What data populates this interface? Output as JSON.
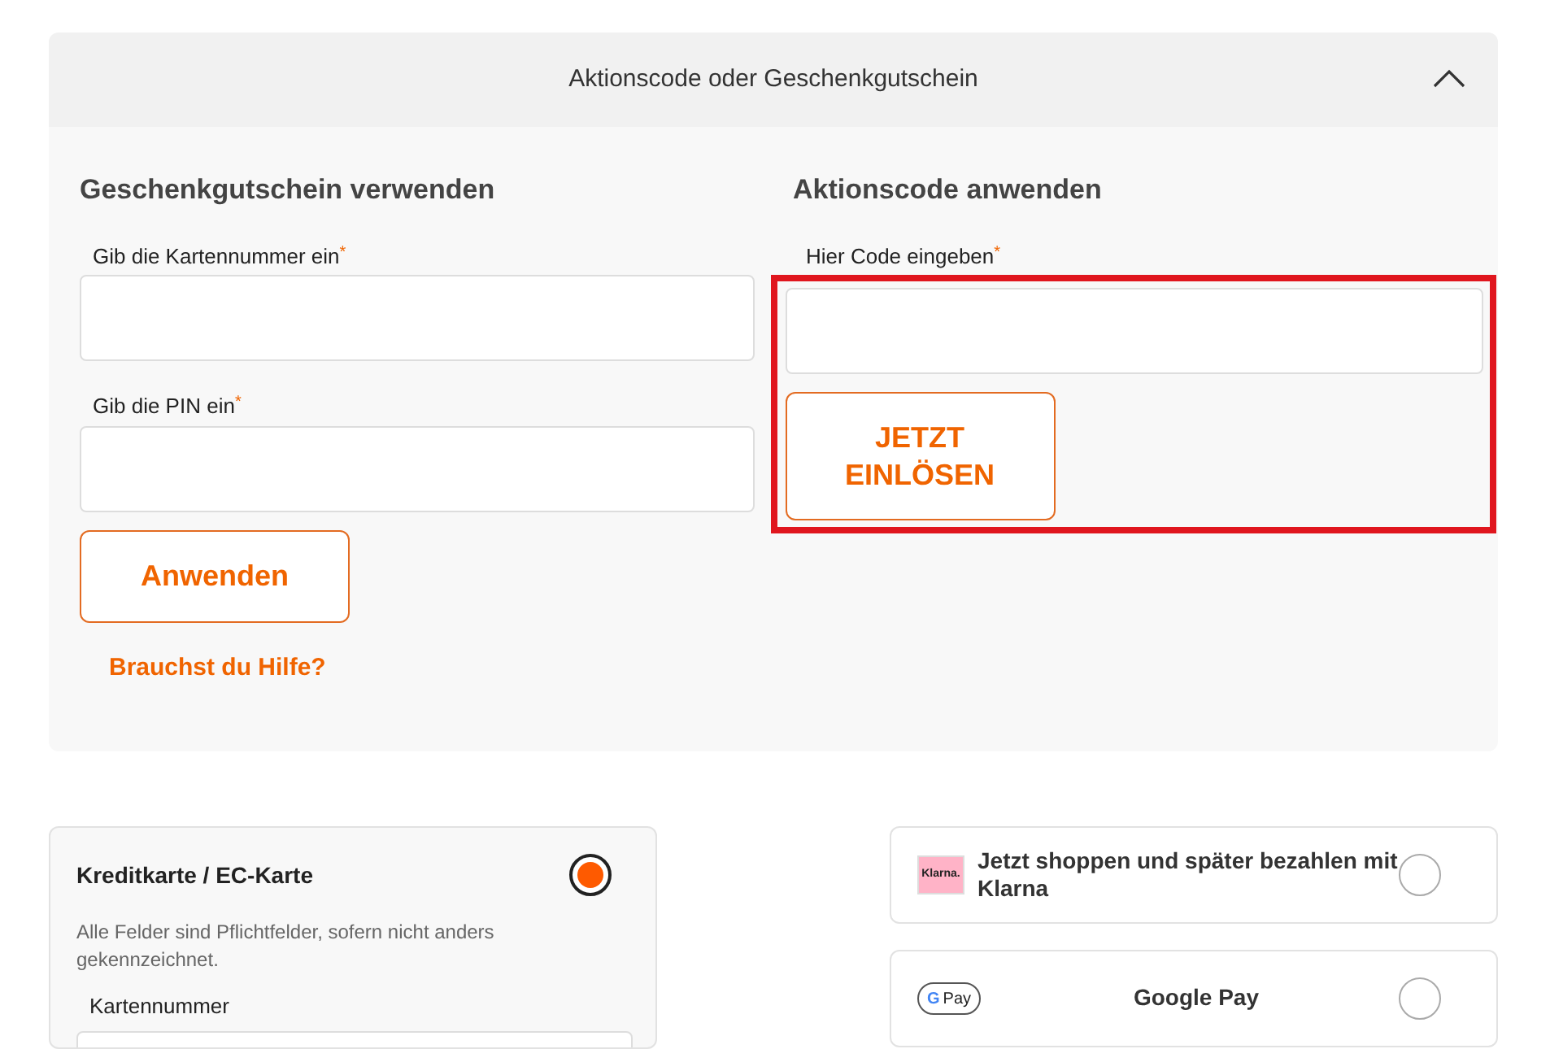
{
  "accordion": {
    "title": "Aktionscode oder Geschenkgutschein",
    "expanded": true
  },
  "gift_card": {
    "heading": "Geschenkgutschein verwenden",
    "fields": [
      {
        "label": "Gib die Kartennummer ein",
        "required_mark": "*"
      },
      {
        "label": "Gib die PIN ein",
        "required_mark": "*"
      }
    ],
    "button": "Anwenden",
    "help_link": "Brauchst du Hilfe?"
  },
  "promo_code": {
    "heading": "Aktionscode anwenden",
    "field": {
      "label": "Hier Code eingeben",
      "required_mark": "*"
    },
    "button": "JETZT EINLÖSEN",
    "highlighted": true
  },
  "payment_methods": [
    {
      "kind": "card",
      "title": "Kreditkarte / EC-Karte",
      "selected": true,
      "note": "Alle Felder sind Pflichtfelder, sofern nicht anders gekennzeichnet.",
      "field_label": "Kartennummer"
    },
    {
      "kind": "klarna",
      "logo": "Klarna.",
      "title": "Jetzt shoppen und später bezahlen mit Klarna",
      "selected": false
    },
    {
      "kind": "gpay",
      "logo_letter": "G",
      "logo": "Pay",
      "title": "Google Pay",
      "selected": false
    }
  ]
}
